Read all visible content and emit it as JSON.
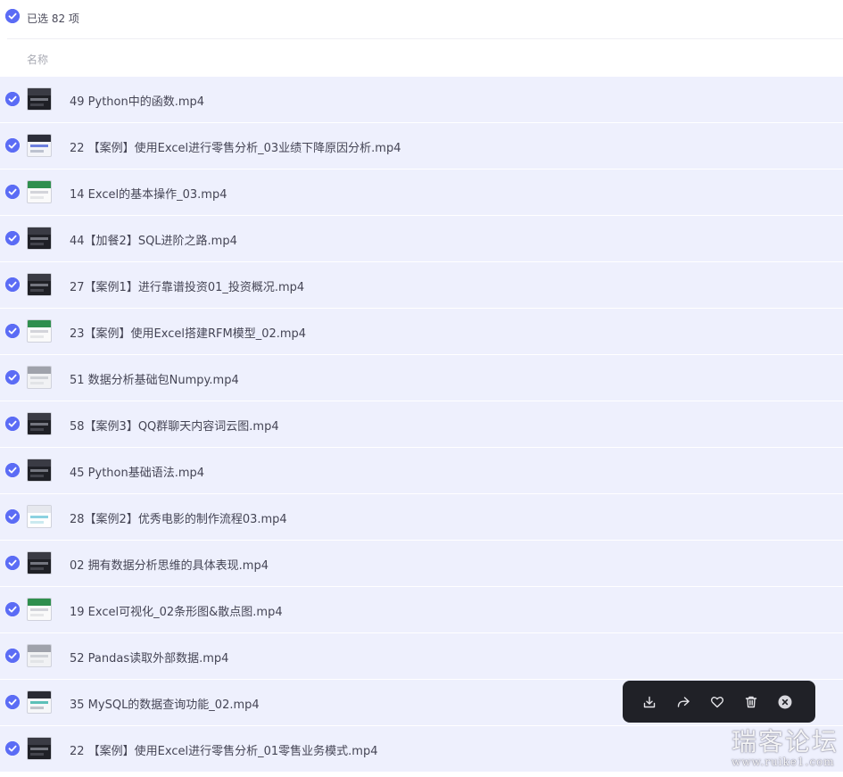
{
  "header": {
    "selected_count_text": "已选 82 项",
    "column_name_label": "名称"
  },
  "files": [
    {
      "name": "49 Python中的函数.mp4",
      "thumb": "dark"
    },
    {
      "name": "22 【案例】使用Excel进行零售分析_03业绩下降原因分析.mp4",
      "thumb": "slide"
    },
    {
      "name": "14 Excel的基本操作_03.mp4",
      "thumb": "sheet"
    },
    {
      "name": "44【加餐2】SQL进阶之路.mp4",
      "thumb": "dark"
    },
    {
      "name": "27【案例1】进行靠谱投资01_投资概况.mp4",
      "thumb": "dark"
    },
    {
      "name": "23【案例】使用Excel搭建RFM模型_02.mp4",
      "thumb": "sheet"
    },
    {
      "name": "51 数据分析基础包Numpy.mp4",
      "thumb": "light"
    },
    {
      "name": "58【案例3】QQ群聊天内容词云图.mp4",
      "thumb": "dark"
    },
    {
      "name": "45 Python基础语法.mp4",
      "thumb": "dark"
    },
    {
      "name": "28【案例2】优秀电影的制作流程03.mp4",
      "thumb": "chart"
    },
    {
      "name": "02 拥有数据分析思维的具体表现.mp4",
      "thumb": "dark"
    },
    {
      "name": "19 Excel可视化_02条形图&散点图.mp4",
      "thumb": "sheet"
    },
    {
      "name": "52 Pandas读取外部数据.mp4",
      "thumb": "light"
    },
    {
      "name": "35 MySQL的数据查询功能_02.mp4",
      "thumb": "db"
    },
    {
      "name": "22 【案例】使用Excel进行零售分析_01零售业务模式.mp4",
      "thumb": "dark"
    }
  ],
  "toolbar": {
    "buttons": [
      "download-icon",
      "share-icon",
      "favorite-icon",
      "delete-icon",
      "close-icon"
    ]
  },
  "watermark": {
    "title": "瑞客论坛",
    "url": "www.ruike1.com"
  },
  "colors": {
    "accent": "#5b6cf5",
    "row_selected_bg": "#eef0fd",
    "toolbar_bg": "#202127"
  }
}
